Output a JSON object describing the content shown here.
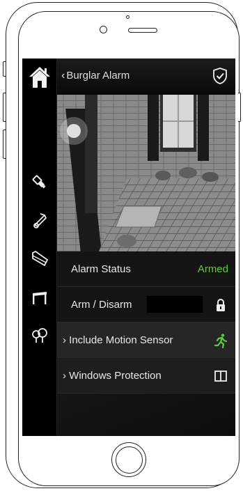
{
  "header": {
    "back_label": "Burglar Alarm"
  },
  "sidebar": {
    "items": [
      {
        "icon": "home-icon"
      },
      {
        "icon": "light-bulb-icon"
      },
      {
        "icon": "music-note-icon"
      },
      {
        "icon": "window-blind-icon"
      },
      {
        "icon": "awning-icon"
      },
      {
        "icon": "garden-tree-icon"
      }
    ]
  },
  "rows": [
    {
      "label": "Alarm Status",
      "value": "Armed"
    },
    {
      "label": "Arm / Disarm",
      "icon": "lock-icon"
    },
    {
      "label": "Include Motion Sensor",
      "icon": "running-man-icon"
    },
    {
      "label": "Windows Protection",
      "icon": "window-icon"
    }
  ],
  "colors": {
    "status_green": "#5fcd3a",
    "background": "#0c0c0c",
    "sidebar": "#000000"
  }
}
